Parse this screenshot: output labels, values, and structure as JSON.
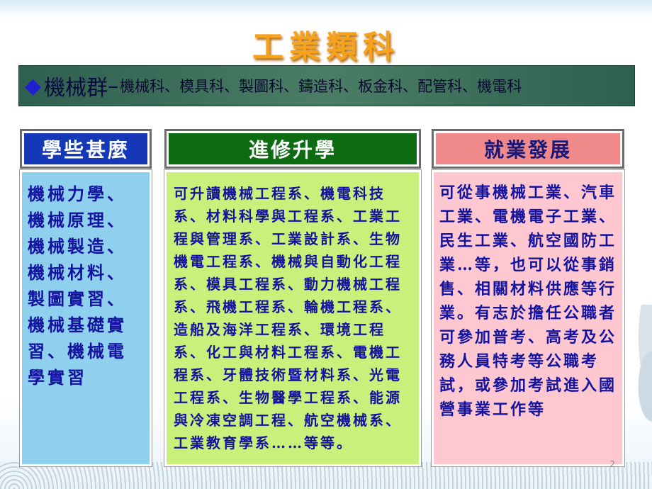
{
  "title": "工業類科",
  "banner": {
    "bullet": "◆",
    "heading": "機械群",
    "separator": "–",
    "subjects": "機械科、模具科、製圖科、鑄造科、板金科、配管科、機電科"
  },
  "columns": [
    {
      "header": "學些甚麼",
      "body": "機械力學、機械原理、機械製造、機械材料、製圖實習、機械基礎實習、機械電學實習"
    },
    {
      "header": "進修升學",
      "body": "可升讀機械工程系、機電科技系、材料科學與工程系、工業工程與管理系、工業設計系、生物機電工程系、機械與自動化工程系、模具工程系、動力機械工程系、飛機工程系、輪機工程系、造船及海洋工程系、環境工程系、化工與材料工程系、電機工程系、牙體技術暨材料系、光電工程系、生物醫學工程系、能源與冷凍空調工程、航空機械系、工業教育學系……等等。"
    },
    {
      "header": "就業發展",
      "body": "可從事機械工業、汽車工業、電機電子工業、民生工業、航空國防工業…等，也可以從事銷售、相關材料供應等行業。有志於擔任公職者可參加普考、高考及公務人員特考等公職考試，或參加考試進入國營事業工作等"
    }
  ],
  "page_number": "2",
  "colors": {
    "title": "#f6a21c",
    "banner_bg": "#3f6f5a",
    "col1_header": "#1538b8",
    "col2_header": "#0d6b12",
    "col3_header": "#f08a8a",
    "col1_body": "#8fd0ee",
    "col2_body": "#c9f07b",
    "col3_body": "#ffc7d0",
    "body_text": "#1313a0"
  }
}
